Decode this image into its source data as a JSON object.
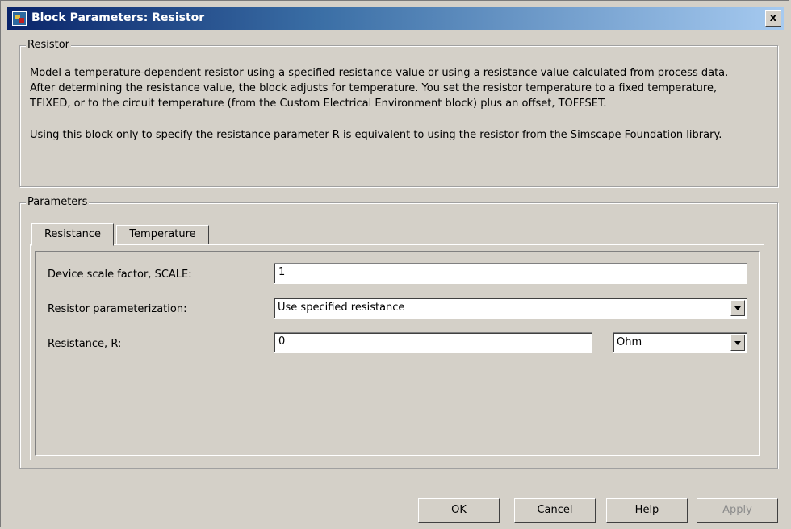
{
  "window": {
    "title": "Block Parameters: Resistor",
    "close_glyph": "x"
  },
  "resistor_group": {
    "label": "Resistor",
    "lines": [
      "Model a temperature-dependent resistor using a specified resistance value or using a resistance value calculated from process data.",
      "After determining the resistance value, the block adjusts for temperature. You set the resistor temperature to a fixed temperature,",
      "TFIXED, or to the circuit temperature (from the Custom Electrical Environment block) plus an offset, TOFFSET.",
      "Using this block only to specify the resistance parameter R is equivalent to using the resistor from the Simscape Foundation library."
    ]
  },
  "parameters_group": {
    "label": "Parameters",
    "tabs": [
      {
        "label": "Resistance",
        "active": true
      },
      {
        "label": "Temperature",
        "active": false
      }
    ],
    "fields": {
      "scale_label": "Device scale factor, SCALE:",
      "scale_value": "1",
      "param_label": "Resistor parameterization:",
      "param_value": "Use specified resistance",
      "resistance_label": "Resistance, R:",
      "resistance_value": "0",
      "resistance_unit": "Ohm"
    }
  },
  "buttons": {
    "ok": "OK",
    "cancel": "Cancel",
    "help": "Help",
    "apply": "Apply"
  }
}
